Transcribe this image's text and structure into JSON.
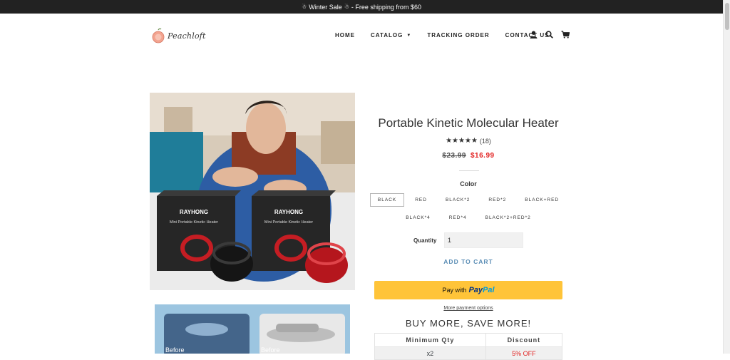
{
  "announcement": {
    "text": "Winter Sale",
    "text2": "- Free shipping from $60"
  },
  "logo": {
    "text": "Peachloft"
  },
  "nav": {
    "home": "HOME",
    "catalog": "CATALOG",
    "tracking": "TRACKING ORDER",
    "contact": "CONTACT US",
    "icons": [
      "account-icon",
      "search-icon",
      "cart-icon"
    ]
  },
  "gallery": {
    "main_image": {
      "box_label_brand": "RAYHONG",
      "box_label_text": "Mini Portable Kinetic Heater"
    },
    "second_image": {
      "label_left": "Before",
      "label_right": "Before"
    }
  },
  "product": {
    "title": "Portable Kinetic Molecular Heater",
    "stars": "★★★★★",
    "rating_value": 5,
    "review_count": "(18)",
    "price_old": "$23.99",
    "price_new": "$16.99",
    "color_label": "Color",
    "color_options_row1": [
      "BLACK",
      "RED",
      "BLACK*2",
      "RED*2",
      "BLACK+RED"
    ],
    "color_options_row2": [
      "BLACK*4",
      "RED*4",
      "BLACK*2+RED*2"
    ],
    "selected_color": "BLACK",
    "quantity_label": "Quantity",
    "quantity_value": "1",
    "add_to_cart": "ADD TO CART",
    "paypal_prefix": "Pay with",
    "paypal_brand_1": "Pay",
    "paypal_brand_2": "Pal",
    "more_payment": "More payment options",
    "buy_more": "BUY MORE, SAVE MORE!",
    "tier_headers": [
      "Minimum Qty",
      "Discount"
    ],
    "tier_rows": [
      {
        "qty": "x2",
        "discount": "5% OFF"
      }
    ]
  },
  "colors": {
    "accent_link": "#5a8db5",
    "sale_red": "#e22120",
    "paypal_yellow": "#ffc439",
    "announce_bg": "#222222"
  }
}
